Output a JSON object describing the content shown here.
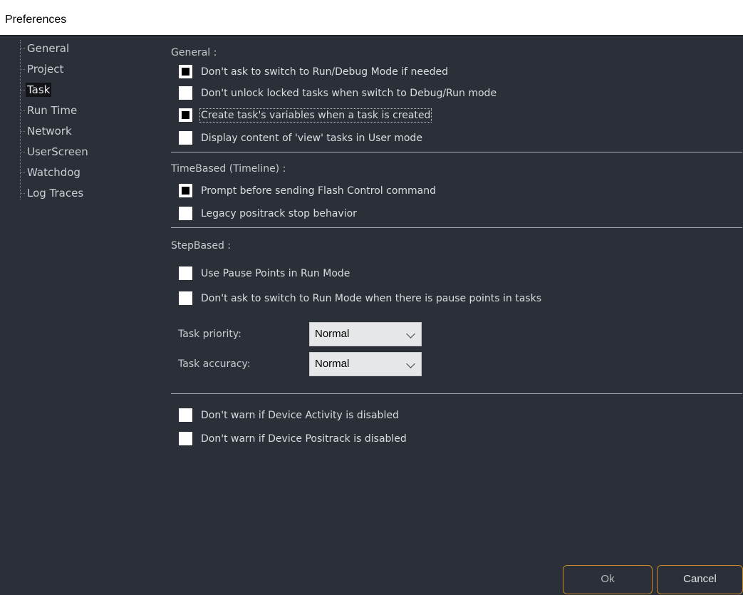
{
  "window": {
    "title": "Preferences"
  },
  "nav": {
    "items": [
      {
        "label": "General"
      },
      {
        "label": "Project"
      },
      {
        "label": "Task"
      },
      {
        "label": "Run Time"
      },
      {
        "label": "Network"
      },
      {
        "label": "UserScreen"
      },
      {
        "label": "Watchdog"
      },
      {
        "label": "Log Traces"
      }
    ],
    "selected": "Task"
  },
  "general": {
    "heading": "General :",
    "options": [
      {
        "label": "Don't ask to switch to Run/Debug Mode if needed",
        "checked": true
      },
      {
        "label": "Don't unlock locked tasks when switch to Debug/Run mode",
        "checked": false
      },
      {
        "label": "Create task's variables when a task is created",
        "checked": true
      },
      {
        "label": "Display content of 'view' tasks in User mode",
        "checked": false
      }
    ]
  },
  "timebased": {
    "heading": "TimeBased (Timeline) :",
    "options": [
      {
        "label": "Prompt before sending Flash Control command",
        "checked": true
      },
      {
        "label": "Legacy positrack stop behavior",
        "checked": false
      }
    ]
  },
  "stepbased": {
    "heading": "StepBased :",
    "options": [
      {
        "label": "Use Pause Points in Run Mode",
        "checked": false
      },
      {
        "label": "Don't ask to switch to Run Mode when there is pause points in tasks",
        "checked": false
      }
    ],
    "priority": {
      "label": "Task priority:",
      "value": "Normal"
    },
    "accuracy": {
      "label": "Task accuracy:",
      "value": "Normal"
    }
  },
  "device": {
    "options": [
      {
        "label": "Don't warn if Device Activity is disabled",
        "checked": false
      },
      {
        "label": "Don't warn if Device Positrack is disabled",
        "checked": false
      }
    ]
  },
  "buttons": {
    "ok": "Ok",
    "cancel": "Cancel"
  },
  "colors": {
    "background": "#2b3038",
    "accent_border": "#c98a28"
  }
}
